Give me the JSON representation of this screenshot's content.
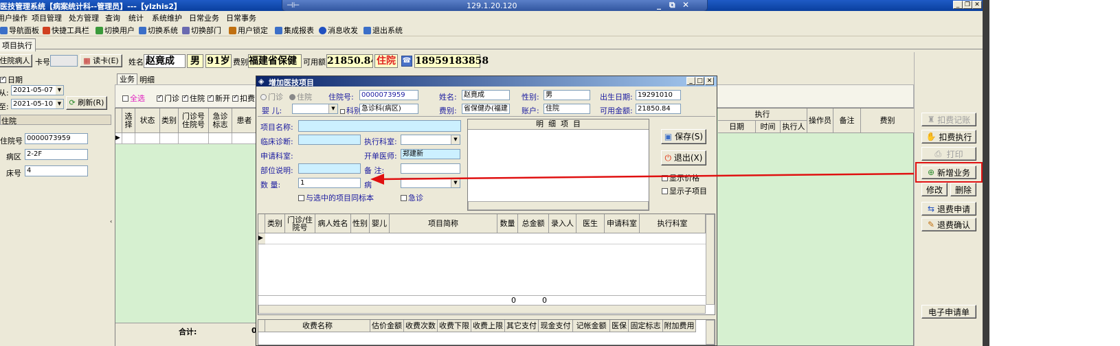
{
  "window": {
    "title": "医技管理系统【病案统计科--管理员】---【ylzhis2】",
    "remote_ip": "129.1.20.120",
    "pin_icon": "pin-icon",
    "controls": [
      "_",
      "⧉",
      "✕"
    ]
  },
  "menu": [
    "用户操作",
    "项目管理",
    "处方管理",
    "查询",
    "统计",
    "系统维护",
    "日常业务",
    "日常事务"
  ],
  "toolbar": [
    {
      "label": "导航面板",
      "icon": "panel-icon",
      "color": "#3b6fc8"
    },
    {
      "label": "快捷工具栏",
      "icon": "tools-icon",
      "color": "#d04020"
    },
    {
      "label": "切换用户",
      "icon": "users-icon",
      "color": "#3a9a3a"
    },
    {
      "label": "切换系统",
      "icon": "system-icon",
      "color": "#3b6fc8"
    },
    {
      "label": "切换部门",
      "icon": "department-icon",
      "color": "#6a6ab0"
    },
    {
      "label": "用户锁定",
      "icon": "lock-icon",
      "color": "#c07010"
    },
    {
      "label": "集成报表",
      "icon": "report-icon",
      "color": "#3b6fc8"
    },
    {
      "label": "消息收发",
      "icon": "info-icon",
      "color": "#2050c0"
    },
    {
      "label": "退出系统",
      "icon": "exit-icon",
      "color": "#3b6fc8"
    }
  ],
  "doc_tab": "项目执行",
  "patient": {
    "type_label": "住院病人",
    "card_label": "卡号",
    "card_value": "",
    "read_card": "读卡(E)",
    "name_label": "姓名",
    "name": "赵竟成",
    "sex": "男",
    "age": "91岁",
    "fee_label": "费别",
    "fee_type": "福建省保健",
    "avail_label": "可用额",
    "avail": "21850.84",
    "status": "住院",
    "phone": "18959183858"
  },
  "left": {
    "date_check": "日期",
    "from_label": "从:",
    "from_date": "2021-05-07",
    "to_label": "至:",
    "to_date": "2021-05-10",
    "refresh": "刷新(R)",
    "section": "住院",
    "inpatient_no_label": "住院号",
    "inpatient_no": "0000073959",
    "ward_label": "病区",
    "ward": "2-2F",
    "bed_label": "床号",
    "bed": "4"
  },
  "main": {
    "tabs": [
      "业务",
      "明细"
    ],
    "filters": [
      "全选",
      "门诊",
      "住院",
      "新开",
      "扣费"
    ],
    "columns": [
      "选择",
      "状态",
      "类别",
      "门诊号\n住院号",
      "急诊\n标志",
      "患者"
    ],
    "exec_group": "执行",
    "exec_columns": [
      "日期",
      "时间",
      "执行人"
    ],
    "right_columns": [
      "操作员",
      "备注",
      "费别"
    ],
    "total_label": "合计:",
    "total_value": "0"
  },
  "right_buttons": [
    {
      "label": "扣费记账",
      "icon": "stamp-icon",
      "enabled": false
    },
    {
      "label": "扣费执行",
      "icon": "hand-icon",
      "enabled": true
    },
    {
      "label": "打印",
      "icon": "printer-icon",
      "enabled": false
    },
    {
      "label": "新增业务",
      "icon": "add-icon",
      "enabled": true
    },
    {
      "label": "修改",
      "icon": "",
      "enabled": true
    },
    {
      "label": "删除",
      "icon": "",
      "enabled": true
    },
    {
      "label": "退费申请",
      "icon": "refund-icon",
      "enabled": true
    },
    {
      "label": "退费确认",
      "icon": "confirm-icon",
      "enabled": true
    },
    {
      "label": "电子申请单",
      "icon": "",
      "enabled": true
    }
  ],
  "dialog": {
    "title": "增加医技项目",
    "radio_outpatient": "门诊",
    "radio_inpatient": "住院",
    "inpatient_no_label": "住院号:",
    "inpatient_no": "0000073959",
    "name_label": "姓名:",
    "name": "赵竟成",
    "sex_label": "性别:",
    "sex": "男",
    "birth_label": "出生日期:",
    "birth": "19291010",
    "infant_label": "婴    儿:",
    "infant": "",
    "dept_label": "科别:",
    "dept": "急诊科(病区)",
    "fee_label": "费别:",
    "fee": "省保健办(福建",
    "account_label": "账户:",
    "account": "住院",
    "avail_label": "可用金额:",
    "avail": "21850.84",
    "item_name_label": "项目名称:",
    "item_name": "",
    "clinical_dx_label": "临床诊断:",
    "clinical_dx": "",
    "exec_dept_label": "执行科室:",
    "exec_dept": "",
    "apply_dept_label": "申请科室:",
    "apply_dept": "",
    "doctor_label": "开单医师:",
    "doctor": "郑建新",
    "site_label": "部位说明:",
    "site": "",
    "remark_label": "备    注:",
    "remark": "",
    "qty_label": "数      量:",
    "qty": "1",
    "specimen_label": "病",
    "specimen": "",
    "same_specimen": "与选中的项目同标本",
    "urgent": "急诊",
    "detail_title": "明  细  项  目",
    "save": "保存(S)",
    "exit": "退出(X)",
    "show_price": "显示价格",
    "show_sub": "显示子项目",
    "grid_columns": [
      "类别",
      "门诊/住\n院号",
      "病人姓名",
      "性别",
      "婴儿",
      "项目简称",
      "数量",
      "总金额",
      "录入人",
      "医生",
      "申请科室",
      "执行科室"
    ],
    "grid_totals": {
      "qty": "0",
      "amount": "0"
    },
    "fee_columns": [
      "收费名称",
      "估价金额",
      "收费次数",
      "收费下限",
      "收费上限",
      "其它支付",
      "现金支付",
      "记帐金额",
      "医保",
      "固定标志",
      "附加费用"
    ]
  }
}
